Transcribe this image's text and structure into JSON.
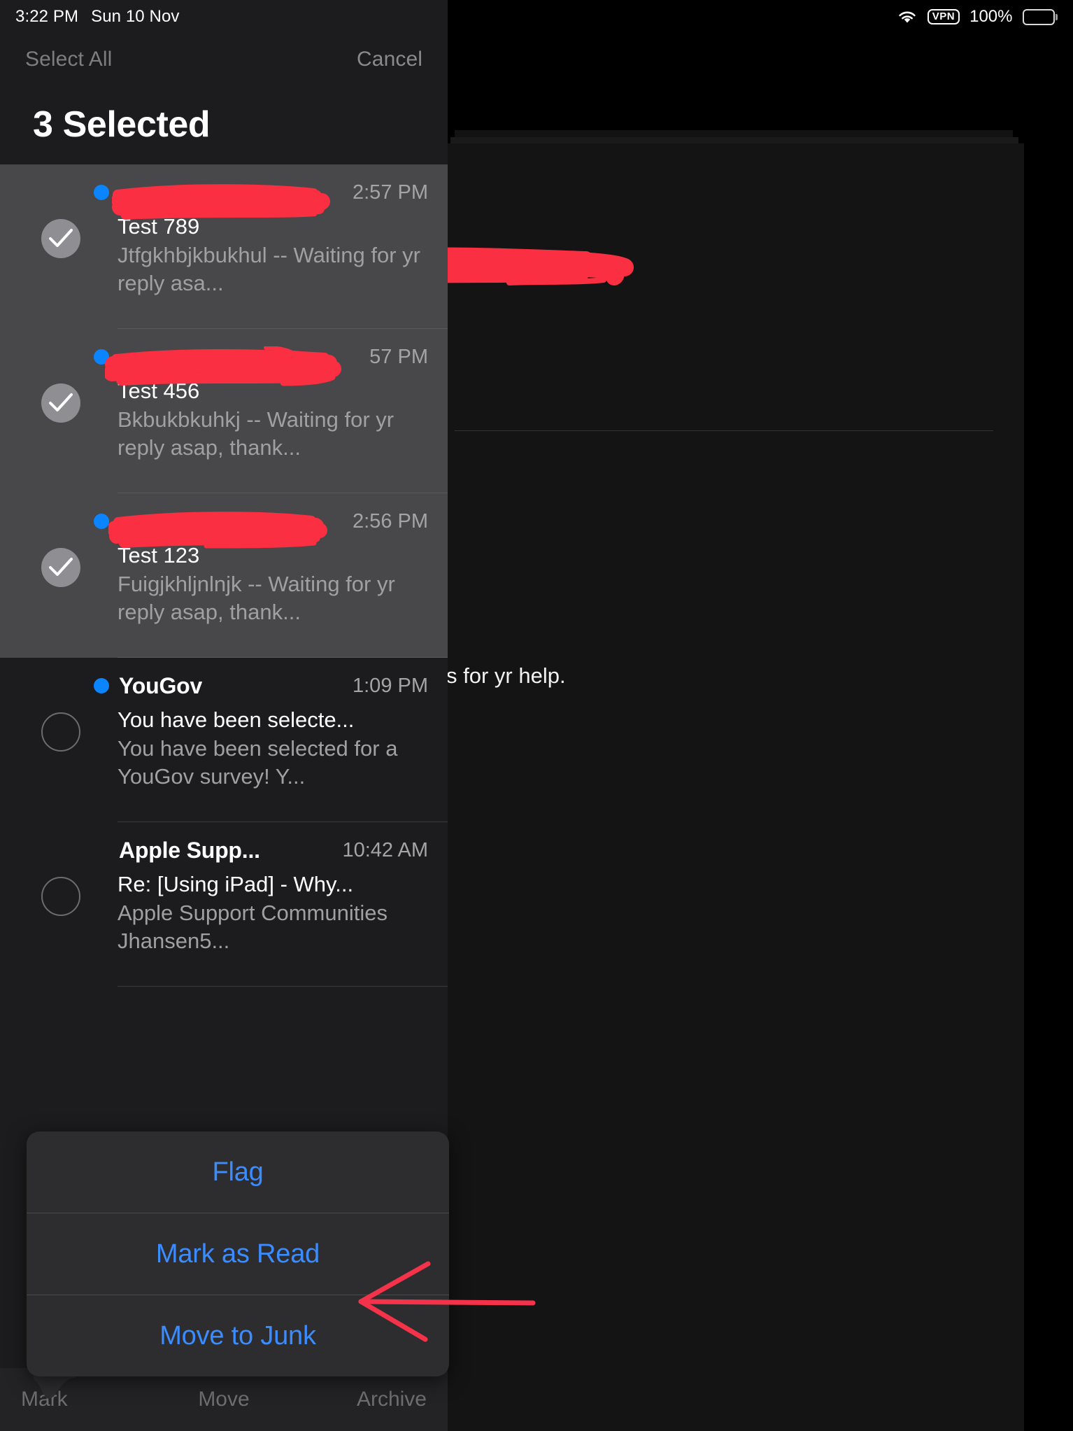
{
  "status_bar": {
    "time": "3:22 PM",
    "date": "Sun 10 Nov",
    "wifi_icon": "wifi-icon",
    "vpn_label": "VPN",
    "battery_percent": "100%",
    "battery_icon": "battery-full-icon"
  },
  "sidebar": {
    "select_all_label": "Select All",
    "cancel_label": "Cancel",
    "title": "3 Selected",
    "messages": [
      {
        "sender": "",
        "sender_redacted": true,
        "time": "2:57 PM",
        "subject": "Test 789",
        "preview": "Jtfgkhbjkbukhul -- Waiting for yr reply asa...",
        "unread": true,
        "selected": true
      },
      {
        "sender": "",
        "sender_redacted": true,
        "time": "57 PM",
        "subject": "Test 456",
        "preview": "Bkbukbkuhkj -- Waiting for yr reply asap, thank...",
        "unread": true,
        "selected": true
      },
      {
        "sender": "",
        "sender_redacted": true,
        "time": "2:56 PM",
        "subject": "Test 123",
        "preview": "Fuigjkhljnlnjk -- Waiting for yr reply asap, thank...",
        "unread": true,
        "selected": true
      },
      {
        "sender": "YouGov",
        "sender_redacted": false,
        "time": "1:09 PM",
        "subject": "You have been selecte...",
        "preview": "You have been selected for a YouGov survey! Y...",
        "unread": true,
        "selected": false
      },
      {
        "sender": "Apple Supp...",
        "sender_redacted": false,
        "time": "10:42 AM",
        "subject": "Re: [Using iPad] - Why...",
        "preview": "Apple Support Communities Jhansen5...",
        "unread": false,
        "selected": false
      }
    ]
  },
  "action_sheet": {
    "items": [
      {
        "label": "Flag"
      },
      {
        "label": "Mark as Read"
      },
      {
        "label": "Move to Junk"
      }
    ]
  },
  "bottom_toolbar": {
    "mark_label": "Mark",
    "move_label": "Move",
    "archive_label": "Archive"
  },
  "detail_pane": {
    "body_text": "s for yr help.",
    "address_redacted": true
  },
  "annotation": {
    "arrow_target": "Move to Junk",
    "arrow_color": "#f4334a"
  },
  "colors": {
    "accent_blue": "#0a84ff",
    "action_blue": "#3b8cff",
    "selected_row_bg": "#48484a",
    "sidebar_bg": "#1c1c1e",
    "redaction_red": "#fa2f42"
  }
}
